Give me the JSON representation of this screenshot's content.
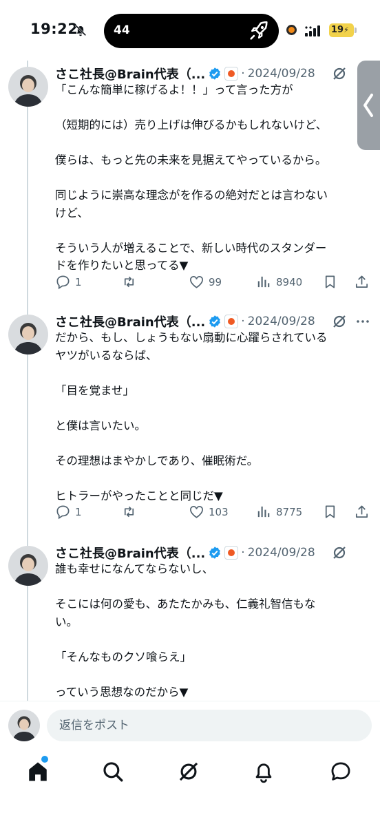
{
  "status_bar": {
    "time": "19:22",
    "island_number": "44",
    "battery": "19",
    "icons": [
      "bell-off-icon",
      "rocket-icon",
      "signal-icon",
      "battery-icon"
    ]
  },
  "tweets": [
    {
      "author": "さこ社長@Brain代表（...",
      "separator": "·",
      "date": "2024/09/28",
      "lines": [
        "「こんな簡単に稼げるよ！！」って言った方が",
        "",
        "（短期的には）売り上げは伸びるかもしれないけど、",
        "",
        "僕らは、もっと先の未来を見据えてやっているから。",
        "",
        "同じように崇高な理念がを作るの絶対だとは言わない",
        "けど、",
        "",
        "そういう人が増えることで、新しい時代のスタンダー",
        "ドを作りたいと思ってる▼"
      ],
      "replies": "1",
      "retweets": "",
      "likes": "99",
      "views": "8940"
    },
    {
      "author": "さこ社長@Brain代表（...",
      "separator": "·",
      "date": "2024/09/28",
      "lines": [
        "だから、もし、しょうもない扇動に心躍らされている",
        "ヤツがいるならば、",
        "",
        "「目を覚ませ」",
        "",
        "と僕は言いたい。",
        "",
        "その理想はまやかしであり、催眠術だ。",
        "",
        "ヒトラーがやったことと同じだ▼"
      ],
      "replies": "1",
      "retweets": "",
      "likes": "103",
      "views": "8775"
    },
    {
      "author": "さこ社長@Brain代表（...",
      "separator": "·",
      "date": "2024/09/28",
      "lines": [
        "誰も幸せになんてならないし、",
        "",
        "そこには何の愛も、あたたかみも、仁義礼智信もな",
        "い。",
        "",
        "「そんなものクソ喰らえ」",
        "",
        "っていう思想なのだから▼"
      ]
    }
  ],
  "reply_bar": {
    "placeholder": "返信をポスト"
  },
  "bottom_nav": {
    "items": [
      "home-icon",
      "search-icon",
      "grok-icon",
      "notifications-icon",
      "messages-icon"
    ]
  },
  "colors": {
    "text": "#0f1419",
    "secondary": "#536471",
    "verified": "#1d9bf0",
    "thread_line": "#cfd9de"
  }
}
